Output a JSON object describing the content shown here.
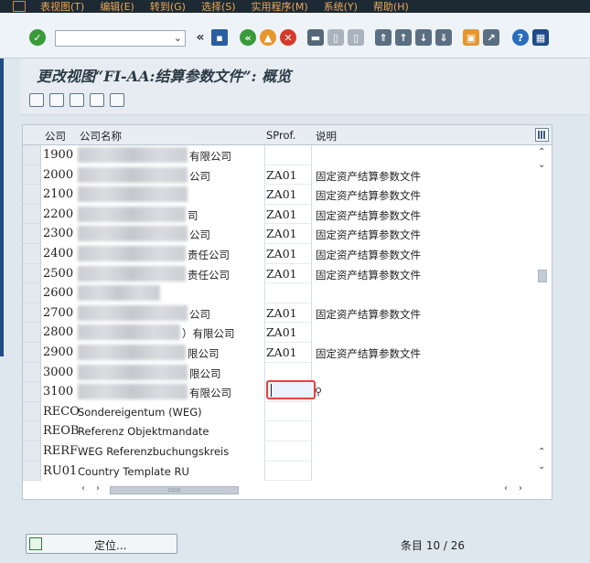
{
  "menu": [
    "表视图(T)",
    "编辑(E)",
    "转到(G)",
    "选择(S)",
    "实用程序(M)",
    "系统(Y)",
    "帮助(H)"
  ],
  "toolbar": {
    "command_value": "",
    "collapse_label": "«"
  },
  "title": "更改视图“FI-AA:结算参数文件”: 概览",
  "table": {
    "headers": {
      "company": "公司",
      "company_name": "公司名称",
      "sprof": "SProf.",
      "desc": "说明"
    },
    "rows": [
      {
        "code": "1900",
        "name_suffix": "有限公司",
        "sprof": "",
        "desc": ""
      },
      {
        "code": "2000",
        "name_suffix": "公司",
        "sprof": "ZA01",
        "desc": "固定资产结算参数文件"
      },
      {
        "code": "2100",
        "name_suffix": "",
        "sprof": "ZA01",
        "desc": "固定资产结算参数文件"
      },
      {
        "code": "2200",
        "name_suffix": "司",
        "sprof": "ZA01",
        "desc": "固定资产结算参数文件"
      },
      {
        "code": "2300",
        "name_suffix": "公司",
        "sprof": "ZA01",
        "desc": "固定资产结算参数文件"
      },
      {
        "code": "2400",
        "name_suffix": "责任公司",
        "sprof": "ZA01",
        "desc": "固定资产结算参数文件"
      },
      {
        "code": "2500",
        "name_suffix": "责任公司",
        "sprof": "ZA01",
        "desc": "固定资产结算参数文件"
      },
      {
        "code": "2600",
        "name_suffix": "",
        "sprof": "",
        "desc": ""
      },
      {
        "code": "2700",
        "name_suffix": "公司",
        "sprof": "ZA01",
        "desc": "固定资产结算参数文件"
      },
      {
        "code": "2800",
        "name_suffix": "）有限公司",
        "sprof": "ZA01",
        "desc": ""
      },
      {
        "code": "2900",
        "name_suffix": "限公司",
        "sprof": "ZA01",
        "desc": "固定资产结算参数文件"
      },
      {
        "code": "3000",
        "name_suffix": "限公司",
        "sprof": "",
        "desc": ""
      },
      {
        "code": "3100",
        "name_suffix": "有限公司",
        "sprof": "",
        "desc": ""
      },
      {
        "code": "RECO",
        "name": "Sondereigentum (WEG)",
        "sprof": "",
        "desc": ""
      },
      {
        "code": "REOB",
        "name": "Referenz Objektmandate",
        "sprof": "",
        "desc": ""
      },
      {
        "code": "RERF",
        "name": "WEG Referenzbuchungskreis",
        "sprof": "",
        "desc": ""
      },
      {
        "code": "RU01",
        "name": "Country Template RU",
        "sprof": "",
        "desc": ""
      }
    ]
  },
  "footer": {
    "position_button": "定位...",
    "entry_label": "条目 10 / 26"
  }
}
